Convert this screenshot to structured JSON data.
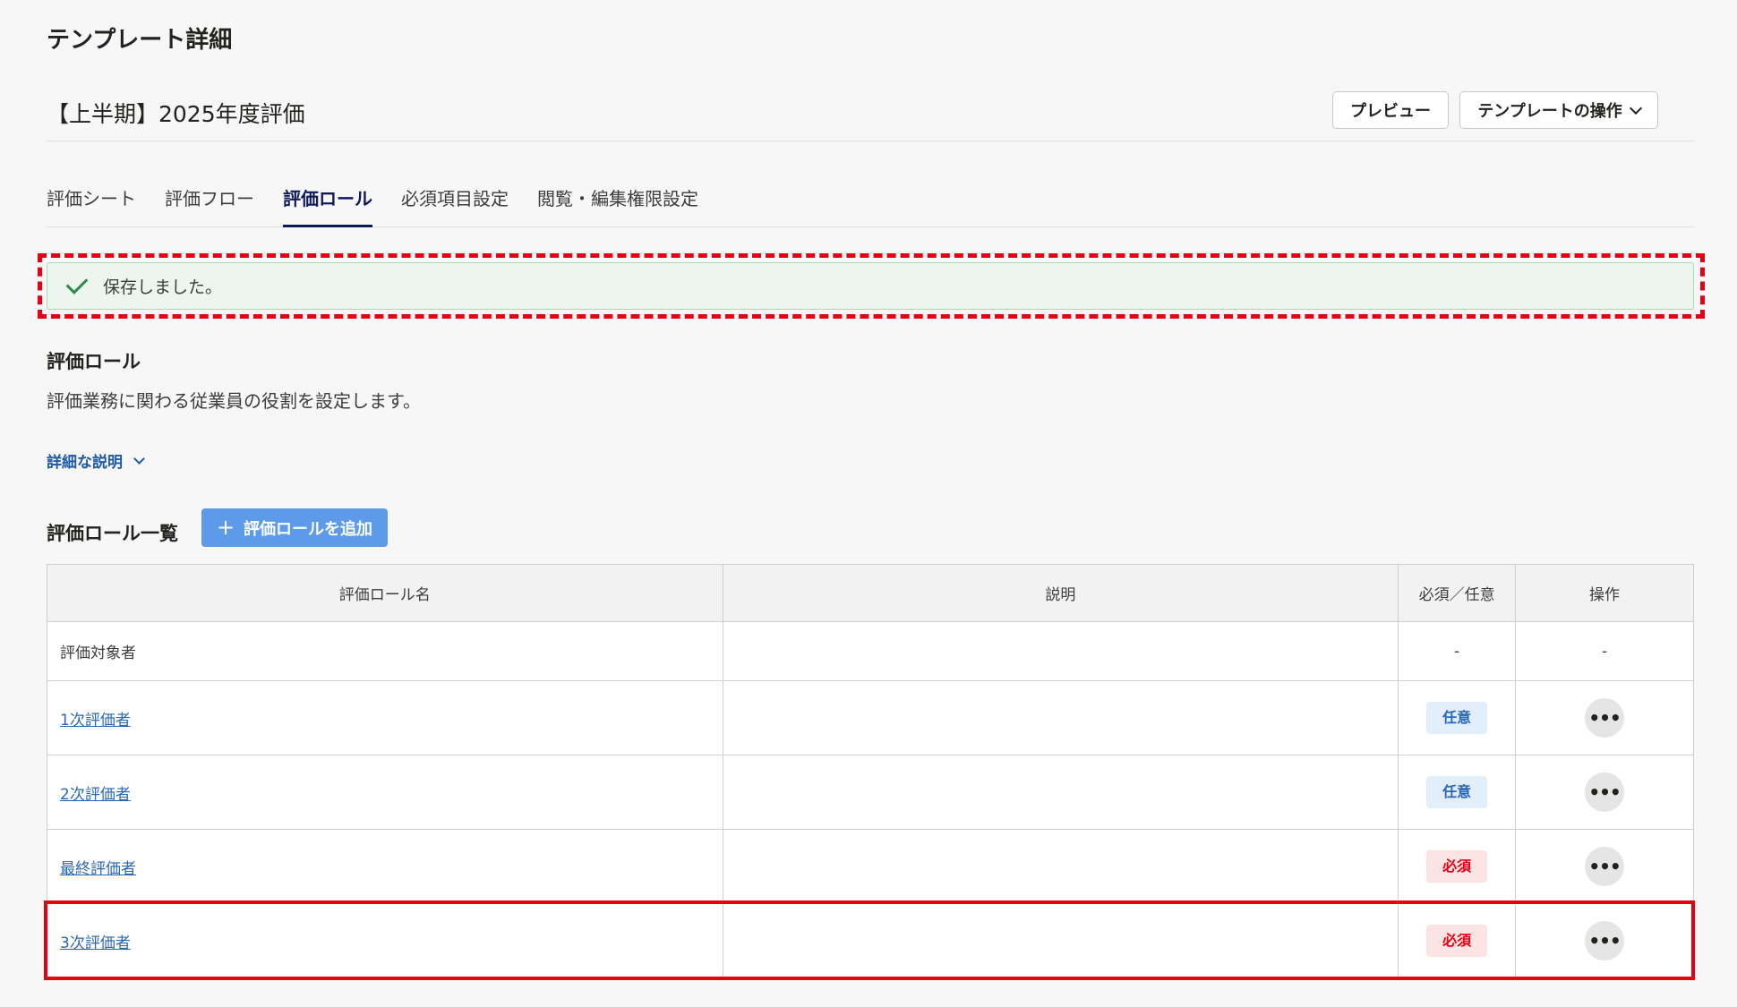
{
  "page": {
    "title": "テンプレート詳細"
  },
  "template": {
    "name": "【上半期】2025年度評価",
    "preview_label": "プレビュー",
    "operations_label": "テンプレートの操作"
  },
  "tabs": [
    {
      "label": "評価シート",
      "active": false
    },
    {
      "label": "評価フロー",
      "active": false
    },
    {
      "label": "評価ロール",
      "active": true
    },
    {
      "label": "必須項目設定",
      "active": false
    },
    {
      "label": "閲覧・編集権限設定",
      "active": false
    }
  ],
  "toast": {
    "message": "保存しました。",
    "icon": "check-icon"
  },
  "section": {
    "title": "評価ロール",
    "description": "評価業務に関わる従業員の役割を設定します。",
    "detail_link": "詳細な説明"
  },
  "list": {
    "title": "評価ロール一覧",
    "add_button": "評価ロールを追加",
    "columns": [
      "評価ロール名",
      "説明",
      "必須／任意",
      "操作"
    ],
    "rows": [
      {
        "name": "評価対象者",
        "description": "",
        "requirement": "-",
        "requirement_kind": "none",
        "action": "-"
      },
      {
        "name": "1次評価者",
        "description": "",
        "requirement": "任意",
        "requirement_kind": "optional",
        "action": "•••"
      },
      {
        "name": "2次評価者",
        "description": "",
        "requirement": "任意",
        "requirement_kind": "optional",
        "action": "•••"
      },
      {
        "name": "最終評価者",
        "description": "",
        "requirement": "必須",
        "requirement_kind": "required",
        "action": "•••"
      },
      {
        "name": "3次評価者",
        "description": "",
        "requirement": "必須",
        "requirement_kind": "required",
        "action": "•••"
      }
    ]
  },
  "colors": {
    "accent": "#0f1a5e",
    "link": "#2a67b5",
    "highlight": "#e60012",
    "success": "#2f8a48"
  }
}
